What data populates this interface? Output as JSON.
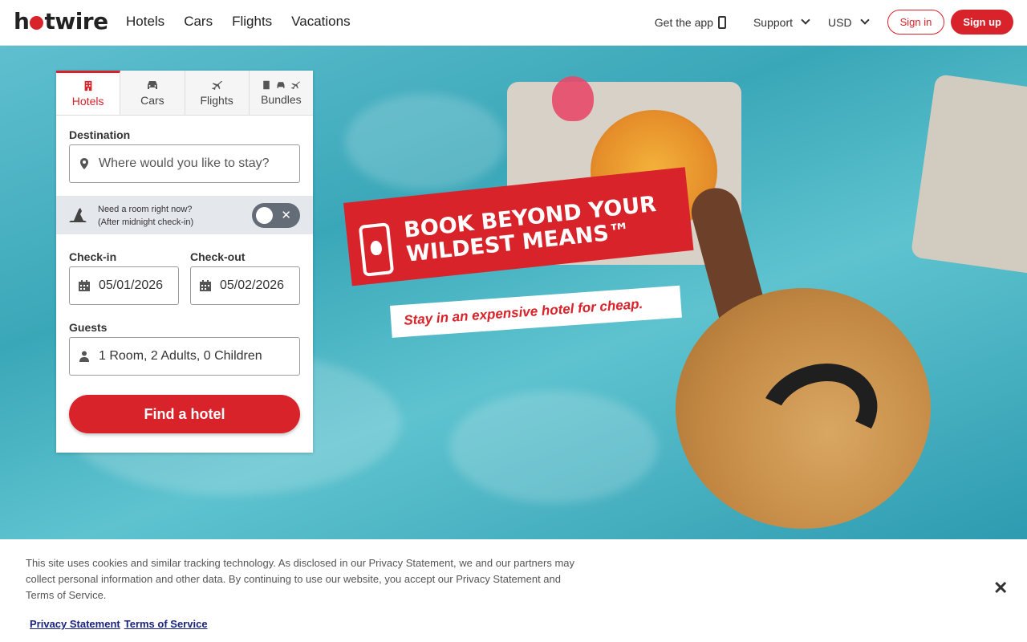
{
  "header": {
    "logo": {
      "part1": "h",
      "part2": "twire"
    },
    "nav": [
      "Hotels",
      "Cars",
      "Flights",
      "Vacations"
    ],
    "get_app": "Get the app",
    "support": "Support",
    "currency": "USD",
    "signin": "Sign in",
    "signup": "Sign up"
  },
  "search": {
    "tabs": [
      "Hotels",
      "Cars",
      "Flights",
      "Bundles"
    ],
    "active_tab": "Hotels",
    "destination_label": "Destination",
    "destination_placeholder": "Where would you like to stay?",
    "last_minute": {
      "line1": "Need a room right now?",
      "line2": "(After midnight check-in)",
      "toggle_on": false
    },
    "checkin_label": "Check-in",
    "checkin_value": "05/01/2026",
    "checkout_label": "Check-out",
    "checkout_value": "05/02/2026",
    "guests_label": "Guests",
    "guests_value": "1 Room, 2 Adults, 0 Children",
    "submit": "Find a hotel"
  },
  "promo": {
    "title": "Book beyond your wildest means™",
    "subtitle": "Stay in an expensive hotel for cheap."
  },
  "cookie": {
    "message": "This site uses cookies and similar tracking technology. As disclosed in our Privacy Statement, we and our partners may collect personal information and other data. By continuing to use our website, you accept our Privacy Statement and Terms of Service.",
    "privacy_link": "Privacy Statement",
    "terms_link": "Terms of Service",
    "close": "✕"
  },
  "colors": {
    "brand": "#d8232a",
    "toggle": "#646c78",
    "link": "#1a237e"
  }
}
